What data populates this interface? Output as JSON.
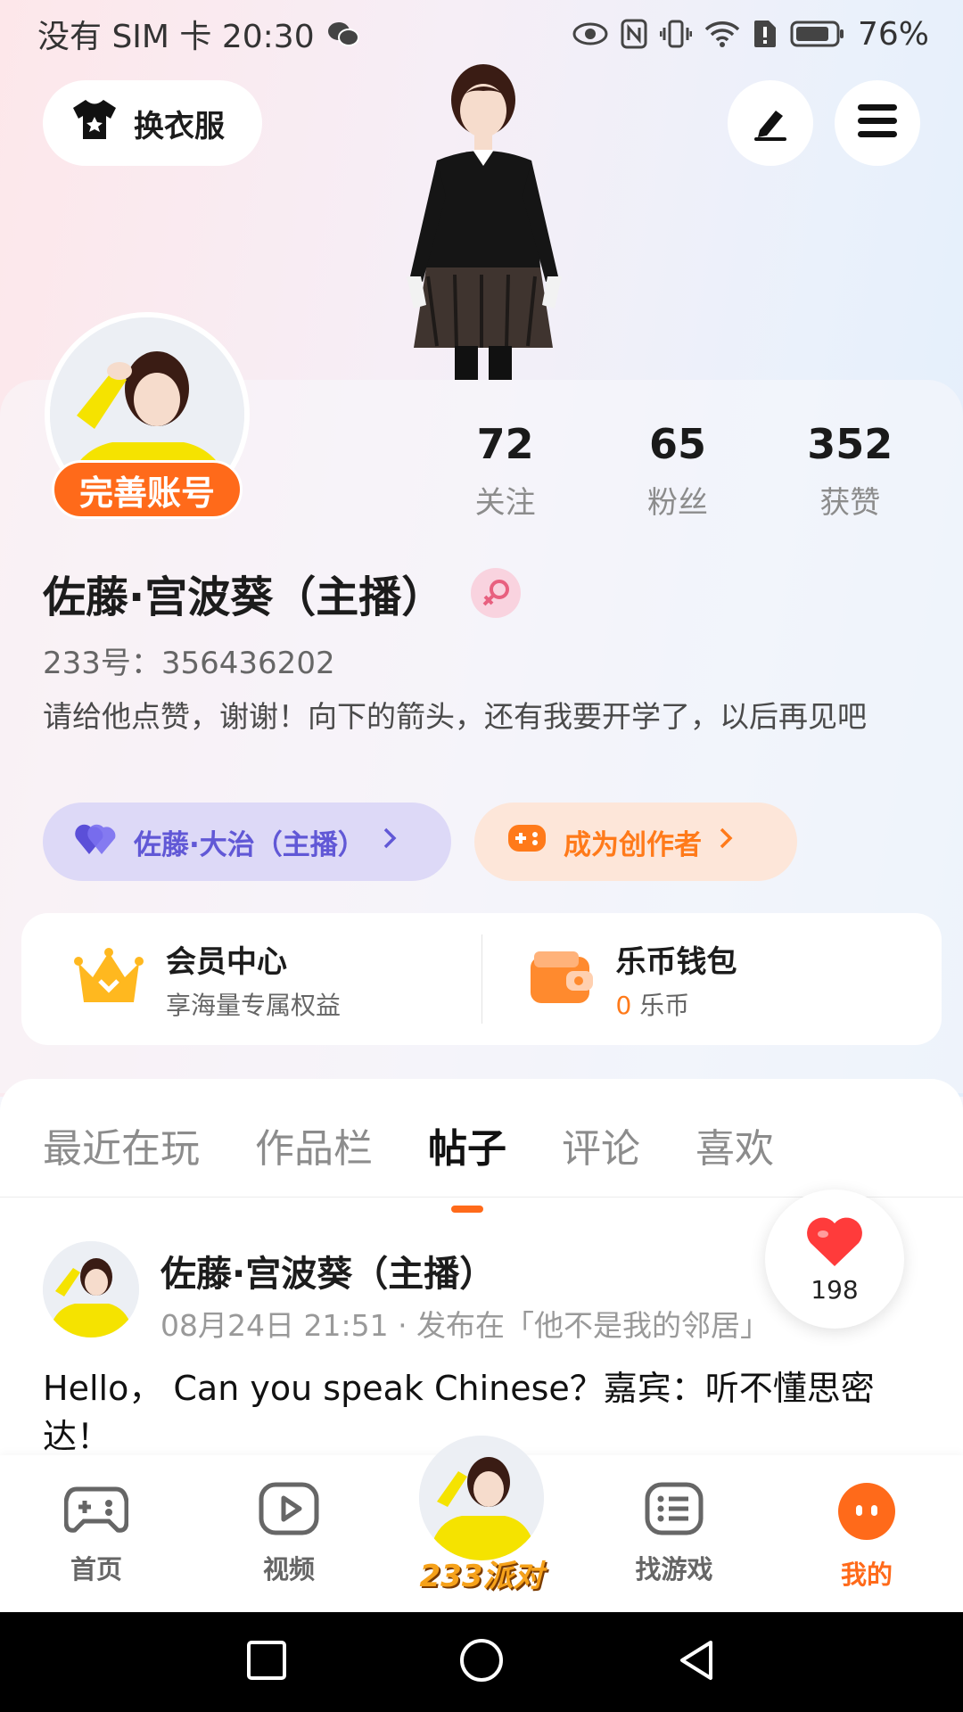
{
  "status_bar": {
    "left_text": "没有 SIM 卡 20:30",
    "battery": "76%"
  },
  "header": {
    "wardrobe_label": "换衣服"
  },
  "profile": {
    "complete_badge": "完善账号",
    "stats": [
      {
        "num": "72",
        "label": "关注"
      },
      {
        "num": "65",
        "label": "粉丝"
      },
      {
        "num": "352",
        "label": "获赞"
      }
    ],
    "name": "佐藤·宫波葵（主播）",
    "user_id": "233号：356436202",
    "bio": "请给他点赞，谢谢！向下的箭头，还有我要开学了，以后再见吧",
    "partner_pill": "佐藤·大治（主播）",
    "creator_pill": "成为创作者"
  },
  "services": {
    "vip_title": "会员中心",
    "vip_sub": "享海量专属权益",
    "wallet_title": "乐币钱包",
    "wallet_amount": "0",
    "wallet_unit": "乐币"
  },
  "tabs": [
    "最近在玩",
    "作品栏",
    "帖子",
    "评论",
    "喜欢"
  ],
  "active_tab": "帖子",
  "post": {
    "author": "佐藤·宫波葵（主播）",
    "meta": "08月24日 21:51 · 发布在「他不是我的邻居」",
    "text": "Hello， Can you speak Chinese？嘉宾：听不懂思密达！",
    "likes": "198"
  },
  "bottom_nav": {
    "home": "首页",
    "video": "视频",
    "party": "233派对",
    "find_game": "找游戏",
    "mine": "我的"
  },
  "colors": {
    "accent": "#ff6a1a",
    "partner": "#6158d6",
    "partner_bg": "#ddd9f7"
  }
}
